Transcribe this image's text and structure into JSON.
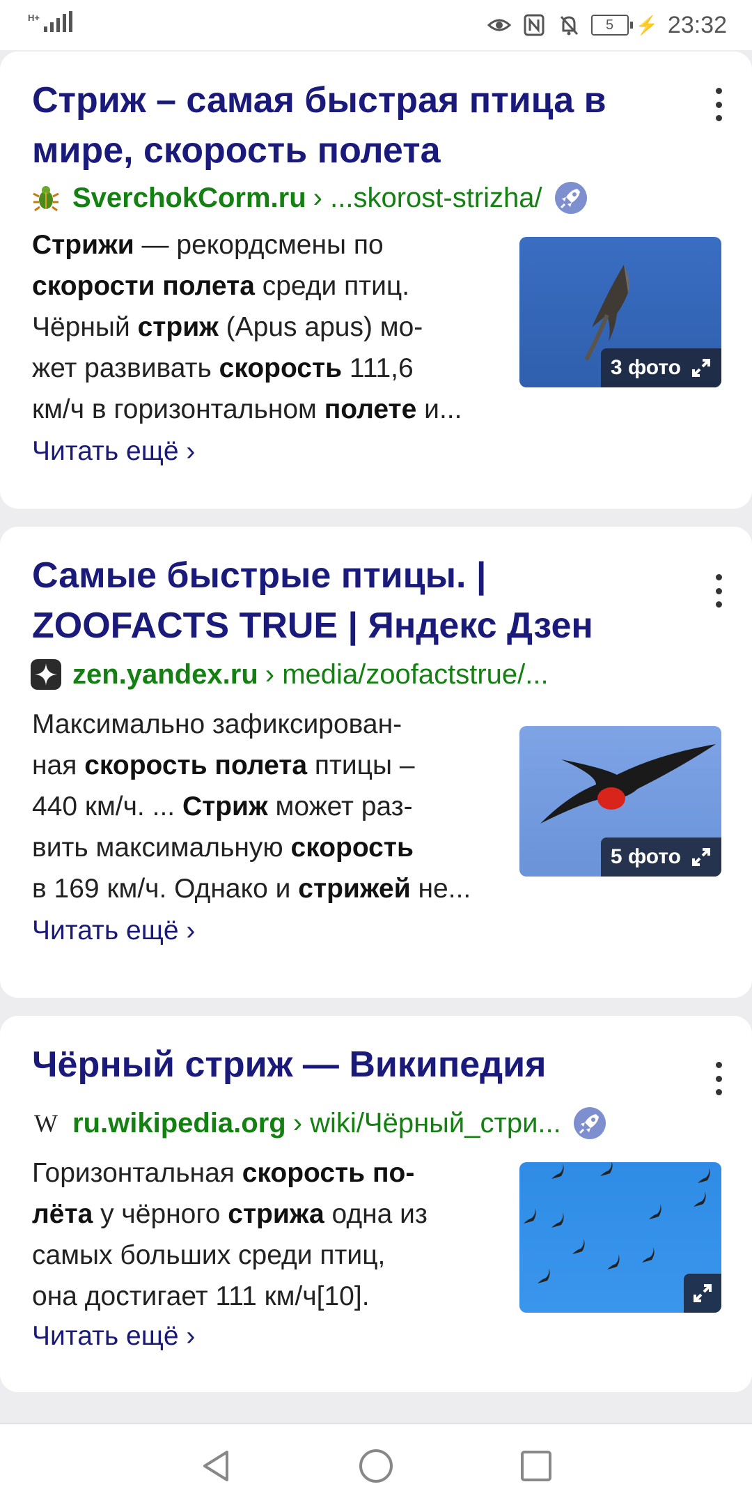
{
  "status_bar": {
    "network": "H+",
    "battery_level": "5",
    "time": "23:32",
    "icons": [
      "signal-icon",
      "eye-icon",
      "nfc-icon",
      "muted-bell-icon",
      "battery-icon",
      "charging-icon"
    ]
  },
  "results": [
    {
      "title": "Стриж – самая быстрая птица в мире, скорость полета",
      "domain": "SverchokCorm.ru",
      "path": "› ...skorost-strizha/",
      "favicon": "bug-icon",
      "has_rocket": true,
      "snippet_lines": [
        [
          [
            "b",
            "Стрижи"
          ],
          [
            "t",
            " — рекордсмены по"
          ]
        ],
        [
          [
            "b",
            "скорости полета"
          ],
          [
            "t",
            " среди птиц."
          ]
        ],
        [
          [
            "t",
            "Чёрный "
          ],
          [
            "b",
            "стриж"
          ],
          [
            "t",
            " (Apus apus) мо-"
          ]
        ],
        [
          [
            "t",
            "жет развивать "
          ],
          [
            "b",
            "скорость"
          ],
          [
            "t",
            " 111,6"
          ]
        ],
        [
          [
            "t",
            "км/ч в горизонтальном "
          ],
          [
            "b",
            "полете"
          ],
          [
            "t",
            " и..."
          ]
        ]
      ],
      "read_more": "Читать ещё ›",
      "photo_badge": "3 фото",
      "image": "swift-in-flight"
    },
    {
      "title": "Самые быстрые птицы. | ZOOFACTS TRUE | Яндекс Дзен",
      "domain": "zen.yandex.ru",
      "path": "› media/zoofactstrue/...",
      "favicon": "zen-star-icon",
      "has_rocket": false,
      "snippet_lines": [
        [
          [
            "t",
            "Максимально зафиксирован-"
          ]
        ],
        [
          [
            "t",
            "ная "
          ],
          [
            "b",
            "скорость полета"
          ],
          [
            "t",
            " птицы –"
          ]
        ],
        [
          [
            "t",
            "440 км/ч. ... "
          ],
          [
            "b",
            "Стриж"
          ],
          [
            "t",
            " может раз-"
          ]
        ],
        [
          [
            "t",
            "вить максимальную "
          ],
          [
            "b",
            "скорость"
          ]
        ],
        [
          [
            "t",
            "в 169 км/ч. Однако и "
          ],
          [
            "b",
            "стрижей"
          ],
          [
            "t",
            " не..."
          ]
        ]
      ],
      "read_more": "Читать ещё ›",
      "photo_badge": "5 фото",
      "image": "frigatebird"
    },
    {
      "title": "Чёрный стриж — Википедия",
      "domain": "ru.wikipedia.org",
      "path": "› wiki/Чёрный_стри...",
      "favicon": "wikipedia-icon",
      "has_rocket": true,
      "snippet_lines": [
        [
          [
            "t",
            "Горизонтальная "
          ],
          [
            "b",
            "скорость по-"
          ]
        ],
        [
          [
            "b",
            "лёта"
          ],
          [
            "t",
            " у чёрного "
          ],
          [
            "b",
            "стрижа"
          ],
          [
            "t",
            " одна из"
          ]
        ],
        [
          [
            "t",
            "самых больших среди птиц,"
          ]
        ],
        [
          [
            "t",
            "она достигает 111 км/ч[10]."
          ]
        ]
      ],
      "read_more": "Читать ещё ›",
      "photo_badge": "",
      "image": "swift-flock"
    }
  ],
  "colors": {
    "title": "#1a1a7a",
    "domain": "#148012",
    "background": "#ededf0"
  }
}
